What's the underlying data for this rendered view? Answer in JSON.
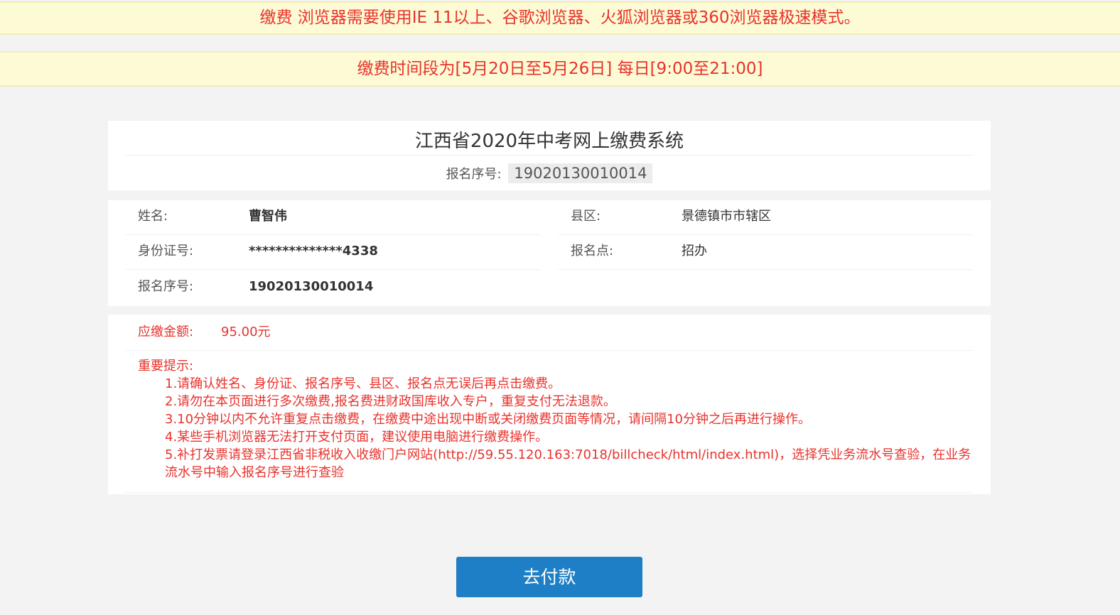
{
  "notices": {
    "browser": "缴费 浏览器需要使用IE 11以上、谷歌浏览器、火狐浏览器或360浏览器极速模式。",
    "period": "缴费时间段为[5月20日至5月26日] 每日[9:00至21:00]"
  },
  "header": {
    "title": "江西省2020年中考网上缴费系统",
    "reg_label": "报名序号:",
    "reg_value": "19020130010014"
  },
  "info": {
    "name_label": "姓名:",
    "name_value": "曹智伟",
    "county_label": "县区:",
    "county_value": "景德镇市市辖区",
    "id_label": "身份证号:",
    "id_value": "**************4338",
    "site_label": "报名点:",
    "site_value": "招办",
    "reg_label": "报名序号:",
    "reg_value": "19020130010014"
  },
  "fee": {
    "label": "应缴金额:",
    "value": "95.00元"
  },
  "tips": {
    "title": "重要提示:",
    "items": [
      "1.请确认姓名、身份证、报名序号、县区、报名点无误后再点击缴费。",
      "2.请勿在本页面进行多次缴费,报名费进财政国库收入专户，重复支付无法退款。",
      "3.10分钟以内不允许重复点击缴费，在缴费中途出现中断或关闭缴费页面等情况，请间隔10分钟之后再进行操作。",
      "4.某些手机浏览器无法打开支付页面，建议使用电脑进行缴费操作。",
      "5.补打发票请登录江西省非税收入收缴门户网站(http://59.55.120.163:7018/billcheck/html/index.html)，选择凭业务流水号查验，在业务流水号中输入报名序号进行查验"
    ]
  },
  "actions": {
    "pay_label": "去付款"
  },
  "colors": {
    "accent_red": "#e8322c",
    "notice_bg": "#fdfbd6",
    "button_blue": "#1e7fc6",
    "page_bg": "#f3f3f3"
  }
}
